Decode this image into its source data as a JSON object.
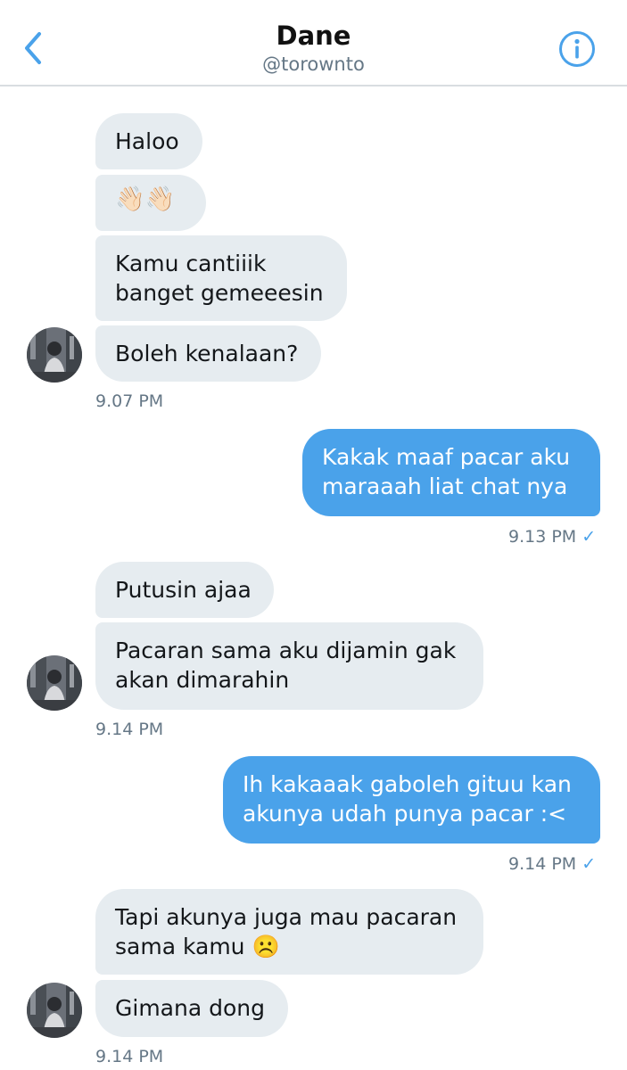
{
  "header": {
    "title": "Dane",
    "handle": "@torownto"
  },
  "messages": {
    "m1": "Haloo",
    "m2": "👋🏻👋🏻",
    "m3a": "Kamu cantiiik",
    "m3b": "banget gemeeesin",
    "m4": "Boleh kenalaan?",
    "t1": "9.07 PM",
    "o1a": "Kakak maaf pacar aku",
    "o1b": "maraaah liat chat nya",
    "t2": "9.13 PM",
    "m5": "Putusin ajaa",
    "m6a": "Pacaran sama aku dijamin gak",
    "m6b": "akan dimarahin",
    "t3": "9.14 PM",
    "o2a": "Ih kakaaak gaboleh gituu kan",
    "o2b": "akunya udah punya pacar :<",
    "t4": "9.14 PM",
    "m7a": "Tapi akunya juga mau pacaran",
    "m7b": "sama kamu ☹️",
    "m8": "Gimana dong",
    "t5": "9.14 PM",
    "check": "✓"
  },
  "colors": {
    "accent": "#4aa2ea",
    "incoming_bg": "#e6ecf0"
  },
  "icons": {
    "back": "chevron-left-icon",
    "info": "info-circle-icon",
    "seen": "check-icon"
  }
}
